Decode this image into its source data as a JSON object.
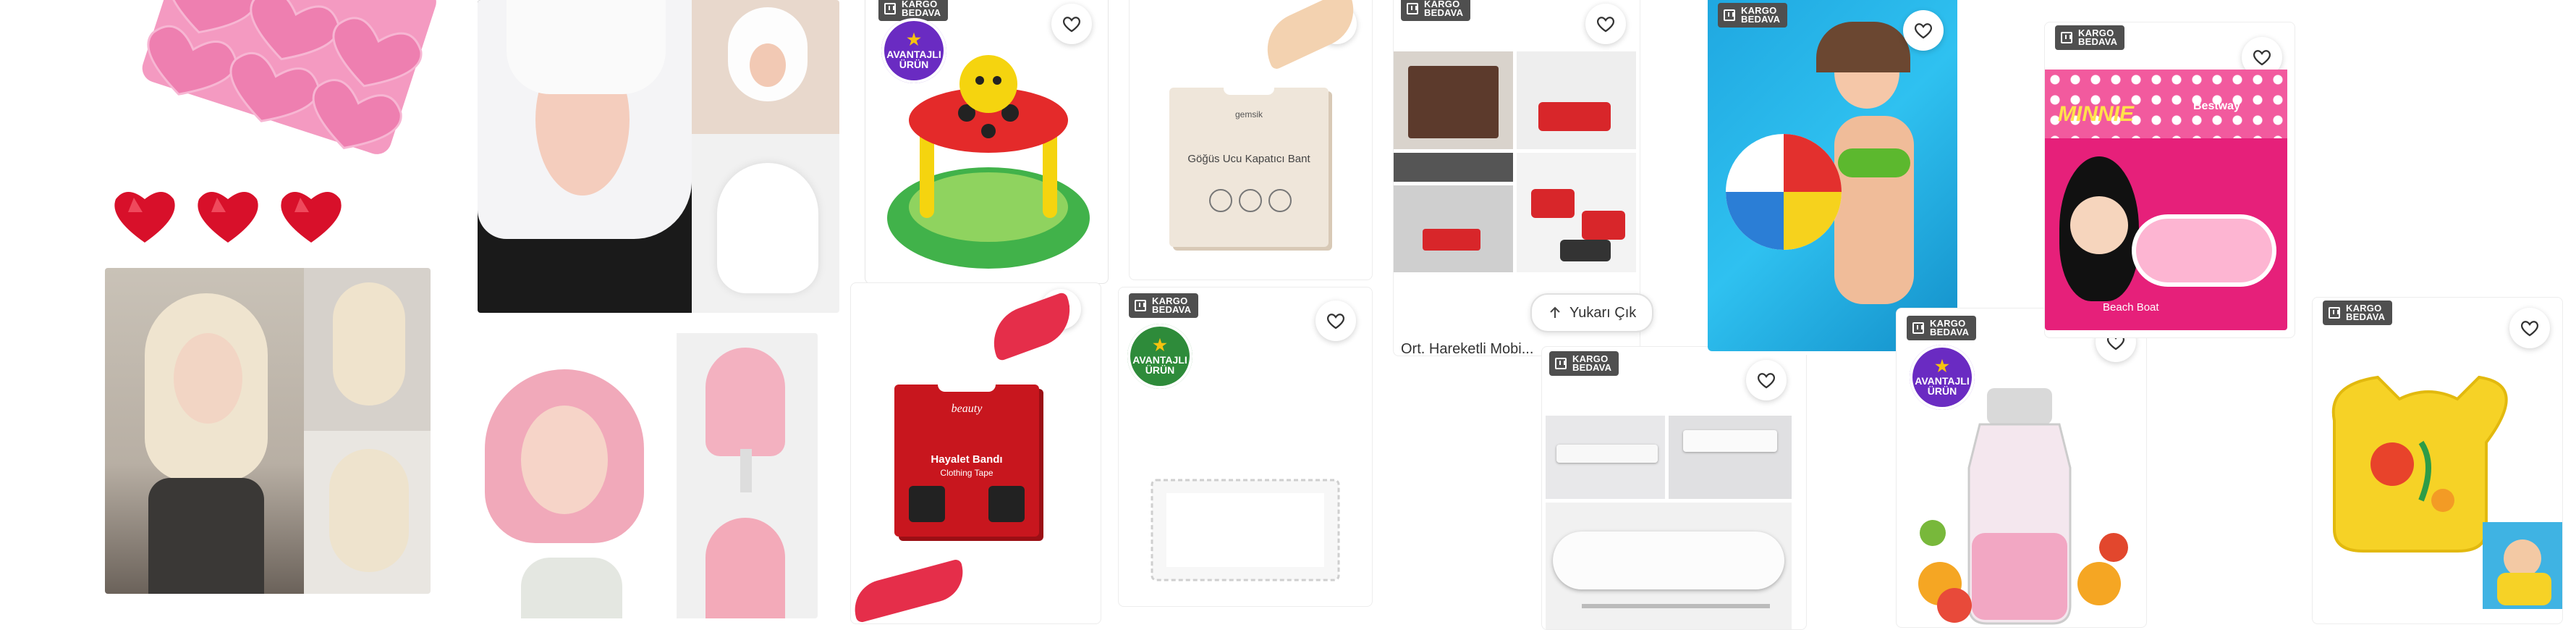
{
  "ui": {
    "kargo_line1": "KARGO",
    "kargo_line2": "BEDAVA",
    "avantaj_line1": "AVANTAJLI",
    "avantaj_line2": "ÜRÜN",
    "scroll_top_label": "Yukarı Çık"
  },
  "products": {
    "soap_box_brand": "gemsik",
    "soap_box_title": "Göğüs Ucu Kapatıcı Bant",
    "red_box_brand": "beauty",
    "red_box_title": "Hayalet Bandı",
    "red_box_sub": "Clothing Tape",
    "pool_brand": "Bestway",
    "pool_label": "MINNIE",
    "pool_name": "Beach Boat",
    "card_partial_title": "Ort. Hareketli Mobi..."
  },
  "colors": {
    "badge": "#4f4f4f",
    "avantaj": "#6a2bc2",
    "avantaj_green": "#2e8b3a",
    "heart_stroke": "#333333"
  },
  "icons": {
    "wishlist": "heart-outline-icon",
    "shipping": "box-icon",
    "scroll_up": "arrow-up-icon"
  }
}
